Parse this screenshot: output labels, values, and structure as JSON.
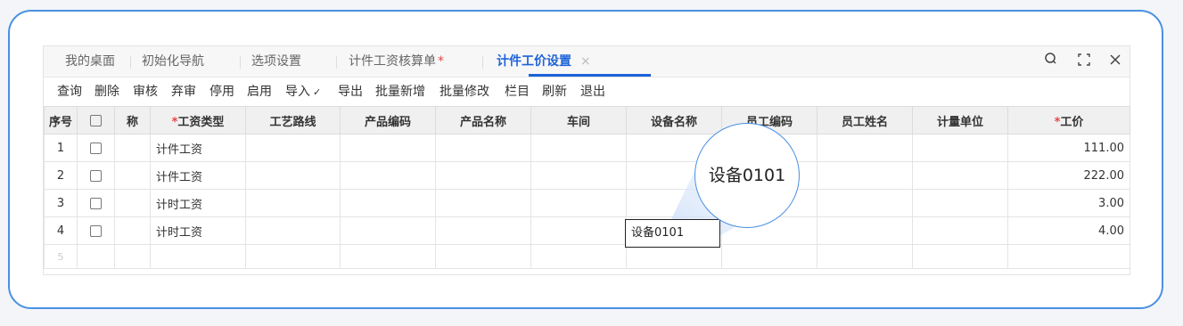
{
  "tabs": [
    {
      "label": "我的桌面"
    },
    {
      "label": "初始化导航"
    },
    {
      "label": "选项设置"
    },
    {
      "label": "计件工资核算单",
      "modified_mark": "*"
    },
    {
      "label": "计件工价设置",
      "close": "×"
    }
  ],
  "window_controls": {
    "search": "⚲",
    "fullscreen": "⛶",
    "close": "✕"
  },
  "toolbar": {
    "query": "查询",
    "delete": "删除",
    "approve": "审核",
    "abandon": "弃审",
    "disable": "停用",
    "enable": "启用",
    "import": "导入",
    "import_arrow": "⌄",
    "export": "导出",
    "batch_add": "批量新增",
    "batch_edit": "批量修改",
    "columns": "栏目",
    "refresh": "刷新",
    "exit": "退出"
  },
  "table": {
    "headers": {
      "seq": "序号",
      "name": "称",
      "wage_type": "工资类型",
      "route": "工艺路线",
      "product_code": "产品编码",
      "product_name": "产品名称",
      "workshop": "车间",
      "device_name": "设备名称",
      "employee_code": "员工编码",
      "employee_name": "员工姓名",
      "unit": "计量单位",
      "price": "工价"
    },
    "required_mark": "*",
    "rows": [
      {
        "seq": "1",
        "wage_type": "计件工资",
        "price": "111.00"
      },
      {
        "seq": "2",
        "wage_type": "计件工资",
        "price": "222.00"
      },
      {
        "seq": "3",
        "wage_type": "计时工资",
        "price": "3.00"
      },
      {
        "seq": "4",
        "wage_type": "计时工资",
        "device_name": "设备0101",
        "price": "4.00"
      },
      {
        "seq": "5"
      }
    ]
  },
  "magnifier_text": "设备0101",
  "colors": {
    "accent": "#1d63d8",
    "frame": "#4a90e2",
    "required": "#e54545"
  }
}
